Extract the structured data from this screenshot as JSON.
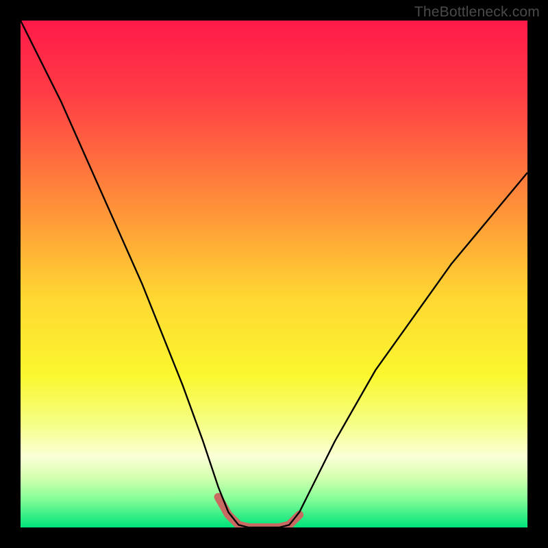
{
  "watermark": "TheBottleneck.com",
  "chart_data": {
    "type": "line",
    "title": "",
    "xlabel": "",
    "ylabel": "",
    "xlim": [
      0,
      100
    ],
    "ylim": [
      0,
      100
    ],
    "grid": false,
    "legend": false,
    "background_gradient": {
      "stops": [
        {
          "offset": 0.0,
          "color": "#ff1a49"
        },
        {
          "offset": 0.15,
          "color": "#ff3e45"
        },
        {
          "offset": 0.35,
          "color": "#ff8a3a"
        },
        {
          "offset": 0.55,
          "color": "#ffd832"
        },
        {
          "offset": 0.7,
          "color": "#faf72e"
        },
        {
          "offset": 0.8,
          "color": "#f5ff8a"
        },
        {
          "offset": 0.86,
          "color": "#fbffd8"
        },
        {
          "offset": 0.9,
          "color": "#d6ffb0"
        },
        {
          "offset": 0.94,
          "color": "#8dff9a"
        },
        {
          "offset": 1.0,
          "color": "#00e27a"
        }
      ]
    },
    "series": [
      {
        "name": "bottleneck-curve",
        "color": "#000000",
        "width": 2.4,
        "x": [
          0,
          4,
          8,
          12,
          16,
          20,
          24,
          28,
          32,
          36,
          39,
          41,
          43,
          45,
          48,
          51,
          53,
          55,
          58,
          62,
          66,
          70,
          75,
          80,
          85,
          90,
          95,
          100
        ],
        "values": [
          100,
          92,
          84,
          75,
          66,
          57,
          48,
          38,
          28,
          17,
          8,
          3,
          0.5,
          0,
          0,
          0,
          0.5,
          3,
          9,
          17,
          24,
          31,
          38,
          45,
          52,
          58,
          64,
          70
        ]
      },
      {
        "name": "optimal-zone-marker",
        "color": "#c96a62",
        "width": 12,
        "linecap": "round",
        "x": [
          39,
          41,
          43,
          45,
          48,
          51,
          53,
          55
        ],
        "values": [
          6,
          2.5,
          0.5,
          0,
          0,
          0,
          0.5,
          2.5
        ]
      }
    ],
    "annotations": []
  }
}
